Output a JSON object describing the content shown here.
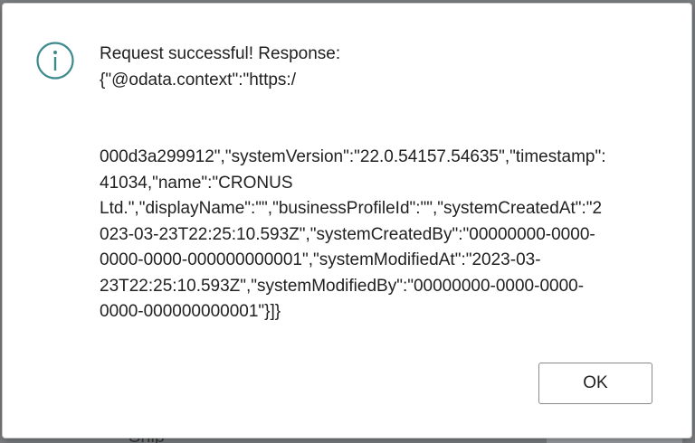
{
  "dialog": {
    "icon": "info-icon",
    "accent_color": "#3c8a8c",
    "message_heading": "Request successful! Response:",
    "message_lines": [
      "{\"@odata.context\":\"https:/",
      "000d3a299912\",\"systemVersion\":\"22.0.54157.54635\",\"timestamp\":",
      "41034,\"name\":\"CRONUS",
      "Ltd.\",\"displayName\":\"\",\"businessProfileId\":\"\",\"systemCreatedAt\":\"2",
      "023-03-23T22:25:10.593Z\",\"systemCreatedBy\":\"00000000-0000-",
      "0000-0000-000000000001\",\"systemModifiedAt\":\"2023-03-",
      "23T22:25:10.593Z\",\"systemModifiedBy\":\"00000000-0000-0000-",
      "0000-000000000001\"}]}"
    ],
    "ok_label": "OK"
  },
  "background": {
    "partial_label": "Ship"
  }
}
